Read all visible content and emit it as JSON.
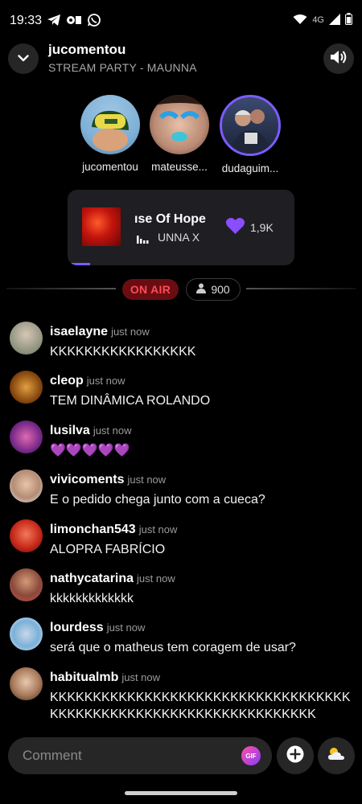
{
  "status_bar": {
    "time": "19:33",
    "network": "4G"
  },
  "header": {
    "title": "jucomentou",
    "subtitle": "STREAM PARTY - MAUNNA"
  },
  "hosts": [
    {
      "name": "jucomentou"
    },
    {
      "name": "mateusse..."
    },
    {
      "name": "dudaguim..."
    }
  ],
  "now_playing": {
    "track": "ıse Of Hope",
    "artist": "UNNA X",
    "likes": "1,9K",
    "progress": 0.1
  },
  "live": {
    "badge": "ON AIR",
    "viewers": "900"
  },
  "chat": [
    {
      "user": "isaelayne",
      "time": "just now",
      "text": "KKKKKKKKKKKKKKKKK"
    },
    {
      "user": "cleop",
      "time": "just now",
      "text": "TEM DINÂMICA ROLANDO"
    },
    {
      "user": "lusilva",
      "time": "just now",
      "text": "💜💜💜💜💜"
    },
    {
      "user": "vivicoments",
      "time": "just now",
      "text": "E o pedido chega junto com a cueca?"
    },
    {
      "user": "limonchan543",
      "time": "just now",
      "text": "ALOPRA FABRÍCIO"
    },
    {
      "user": "nathycatarina",
      "time": "just now",
      "text": "kkkkkkkkkkkkk"
    },
    {
      "user": "lourdess",
      "time": "just now",
      "text": " será que o matheus tem coragem de usar?"
    },
    {
      "user": "habitualmb",
      "time": "just now",
      "text": "KKKKKKKKKKKKKKKKKKKKKKKKKKKKKKKKKKKKKKKKKKKKKKKKKKKKKKKKKKKKKKKKKK"
    }
  ],
  "composer": {
    "placeholder": "Comment",
    "gif_label": "GIF"
  },
  "colors": {
    "accent": "#7b5cff",
    "onair_bg": "#6a0d12",
    "onair_text": "#ff4b56"
  }
}
